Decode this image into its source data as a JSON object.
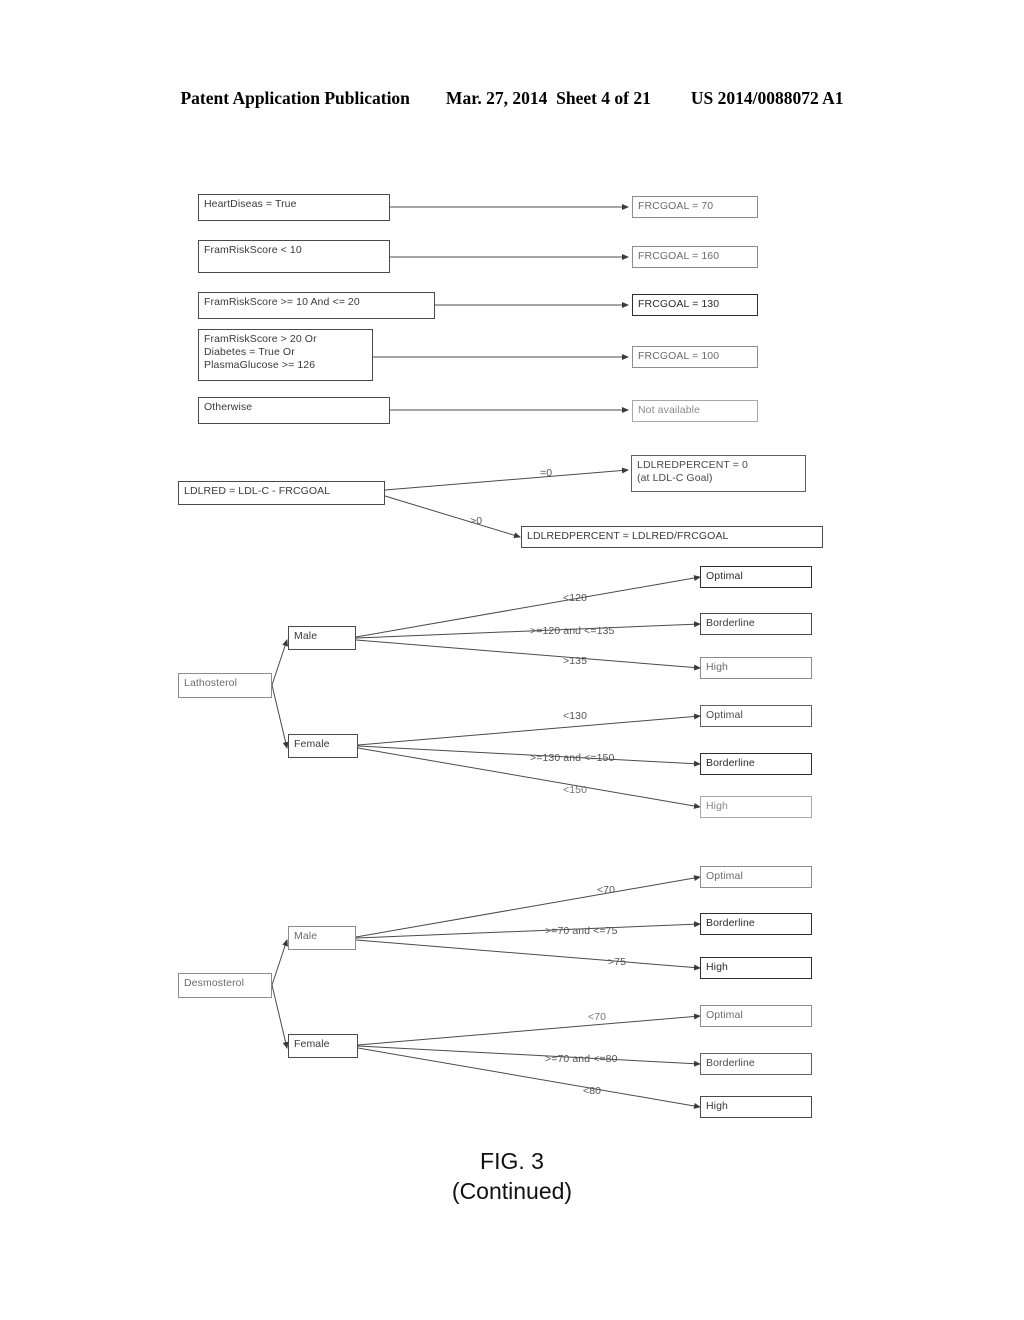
{
  "header": {
    "publication": "Patent Application Publication",
    "date_sheet": "Mar. 27, 2014  Sheet 4 of 21",
    "patent_number": "US 2014/0088072 A1"
  },
  "caption": {
    "figure": "FIG. 3",
    "continued": "(Continued)"
  },
  "diagram": {
    "type": "flowchart",
    "sections": [
      {
        "name": "frcgoal-rules",
        "conditions": [
          "HeartDiseas = True",
          "FramRiskScore < 10",
          "FramRiskScore >= 10 And <= 20",
          "FramRiskScore > 20 Or\nDiabetes = True Or\nPlasmaGlucose >= 126",
          "Otherwise"
        ],
        "results": [
          "FRCGOAL = 70",
          "FRCGOAL = 160",
          "FRCGOAL = 130",
          "FRCGOAL = 100",
          "Not available"
        ]
      },
      {
        "name": "ldlred-calculation",
        "source": "LDLRED = LDL-C - FRCGOAL",
        "branches": [
          {
            "label": "=0",
            "target": "LDLREDPERCENT = 0\n(at LDL-C Goal)"
          },
          {
            "label": ">0",
            "target": "LDLREDPERCENT = LDLRED/FRCGOAL"
          }
        ]
      },
      {
        "name": "lathosterol-tree",
        "root": "Lathosterol",
        "groups": [
          {
            "sex": "Male",
            "branches": [
              {
                "label": "<120",
                "result": "Optimal"
              },
              {
                "label": ">=120 and <=135",
                "result": "Borderline"
              },
              {
                "label": ">135",
                "result": "High"
              }
            ]
          },
          {
            "sex": "Female",
            "branches": [
              {
                "label": "<130",
                "result": "Optimal"
              },
              {
                "label": ">=130 and <=150",
                "result": "Borderline"
              },
              {
                "label": "<150",
                "result": "High"
              }
            ]
          }
        ]
      },
      {
        "name": "desmosterol-tree",
        "root": "Desmosterol",
        "groups": [
          {
            "sex": "Male",
            "branches": [
              {
                "label": "<70",
                "result": "Optimal"
              },
              {
                "label": ">=70 and <=75",
                "result": "Borderline"
              },
              {
                "label": ">75",
                "result": "High"
              }
            ]
          },
          {
            "sex": "Female",
            "branches": [
              {
                "label": "<70",
                "result": "Optimal"
              },
              {
                "label": ">=70 and <=80",
                "result": "Borderline"
              },
              {
                "label": "<80",
                "result": "High"
              }
            ]
          }
        ]
      }
    ]
  }
}
